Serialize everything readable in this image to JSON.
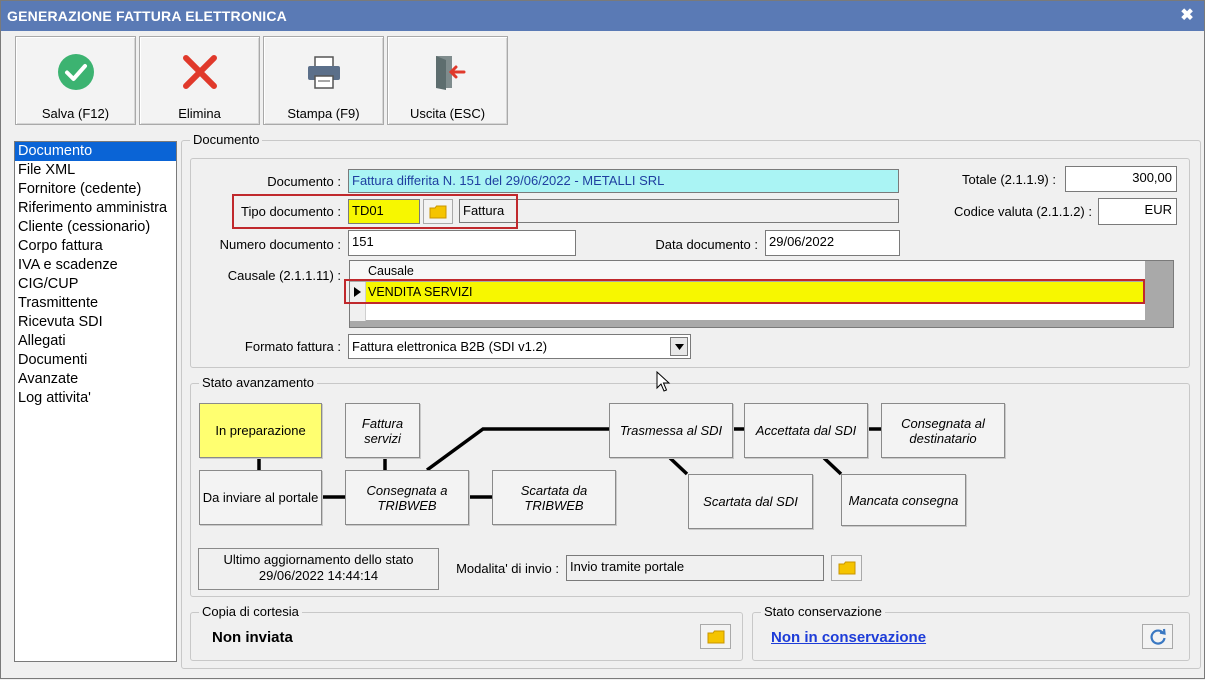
{
  "window": {
    "title": "GENERAZIONE FATTURA ELETTRONICA",
    "close_glyph": "✖"
  },
  "toolbar": {
    "save_label": "Salva (F12)",
    "delete_label": "Elimina",
    "print_label": "Stampa (F9)",
    "exit_label": "Uscita (ESC)"
  },
  "sidebar": {
    "items": [
      {
        "label": "Documento",
        "selected": true
      },
      {
        "label": "File XML"
      },
      {
        "label": "Fornitore (cedente)"
      },
      {
        "label": "Riferimento amministra"
      },
      {
        "label": "Cliente (cessionario)"
      },
      {
        "label": "Corpo fattura"
      },
      {
        "label": "IVA e scadenze"
      },
      {
        "label": "CIG/CUP"
      },
      {
        "label": "Trasmittente"
      },
      {
        "label": "Ricevuta SDI"
      },
      {
        "label": "Allegati"
      },
      {
        "label": "Documenti"
      },
      {
        "label": "Avanzate"
      },
      {
        "label": "Log attivita'"
      }
    ]
  },
  "documento": {
    "group_title": "Documento",
    "documento_label": "Documento :",
    "documento_value": "Fattura differita N. 151 del 29/06/2022 - METALLI SRL",
    "tipo_label": "Tipo documento :",
    "tipo_code": "TD01",
    "tipo_desc": "Fattura",
    "numero_label": "Numero documento :",
    "numero_value": "151",
    "data_label": "Data documento :",
    "data_value": "29/06/2022",
    "totale_label": "Totale (2.1.1.9) :",
    "totale_value": "300,00",
    "valuta_label": "Codice valuta (2.1.1.2) :",
    "valuta_value": "EUR",
    "causale_label": "Causale (2.1.1.11) :",
    "causale_header": "Causale",
    "causale_rows": [
      "VENDITA SERVIZI"
    ],
    "formato_label": "Formato fattura :",
    "formato_value": "Fattura elettronica B2B (SDI v1.2)"
  },
  "stato_avanzamento": {
    "group_title": "Stato avanzamento",
    "states": {
      "in_preparazione": "In preparazione",
      "fattura_servizi": "Fattura servizi",
      "da_inviare": "Da inviare al portale",
      "consegnata_tribweb": "Consegnata a TRIBWEB",
      "scartata_tribweb": "Scartata da TRIBWEB",
      "trasmessa_sdi": "Trasmessa al SDI",
      "accettata_sdi": "Accettata dal SDI",
      "consegnata_destinatario": "Consegnata al destinatario",
      "scartata_sdi": "Scartata dal SDI",
      "mancata_consegna": "Mancata consegna"
    },
    "ultimo_aggiornamento_label": "Ultimo aggiornamento dello stato",
    "ultimo_aggiornamento_value": "29/06/2022 14:44:14",
    "modalita_label": "Modalita' di invio :",
    "modalita_value": "Invio tramite portale"
  },
  "copia_cortesia": {
    "group_title": "Copia di cortesia",
    "value": "Non inviata"
  },
  "stato_conservazione": {
    "group_title": "Stato conservazione",
    "value": "Non in conservazione"
  },
  "colors": {
    "titlebar": "#5a7ab5",
    "selection": "#0a64d6",
    "highlight_yellow": "#f7f700",
    "cyan_field": "#aaf4f4",
    "red_frame": "#c0282c",
    "link": "#1d3cd8"
  },
  "icons": [
    "check-icon",
    "x-icon",
    "printer-icon",
    "exit-door-icon",
    "folder-icon",
    "refresh-icon",
    "row-pointer-icon",
    "dropdown-arrow-icon"
  ]
}
